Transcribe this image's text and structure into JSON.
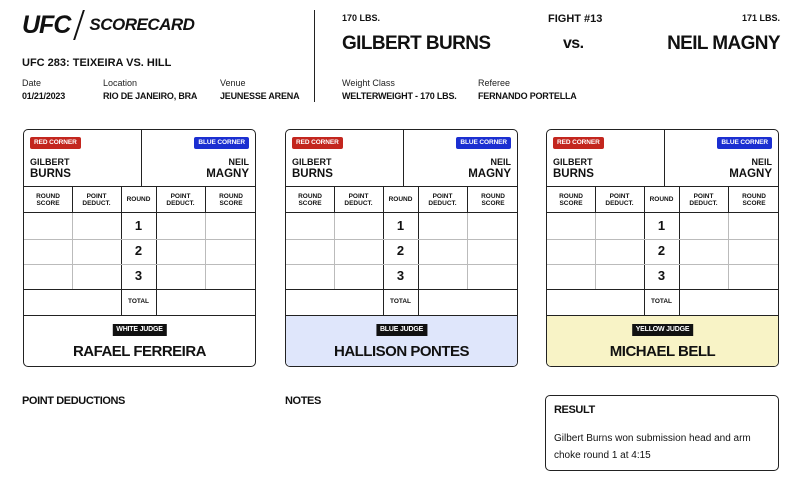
{
  "header": {
    "logo_text": "UFC",
    "logo_sub": "SCORECARD",
    "event": "UFC 283: TEIXEIRA VS. HILL",
    "date_label": "Date",
    "date": "01/21/2023",
    "location_label": "Location",
    "location": "RIO DE JANEIRO, BRA",
    "venue_label": "Venue",
    "venue": "JEUNESSE ARENA"
  },
  "fight": {
    "red_weight": "170 LBS.",
    "red_name": "GILBERT BURNS",
    "number": "FIGHT #13",
    "vs": "vs.",
    "blue_weight": "171 LBS.",
    "blue_name": "NEIL MAGNY",
    "weight_class_label": "Weight Class",
    "weight_class": "WELTERWEIGHT - 170 LBS.",
    "referee_label": "Referee",
    "referee": "FERNANDO PORTELLA"
  },
  "colors": {
    "red_corner": "#c3261e",
    "blue_corner": "#1b2fd1",
    "blue_judge_bg": "#dfe6fb",
    "yellow_judge_bg": "#f8f3c6"
  },
  "card_labels": {
    "red_corner": "RED CORNER",
    "blue_corner": "BLUE CORNER",
    "red_first": "GILBERT",
    "red_last": "BURNS",
    "blue_first": "NEIL",
    "blue_last": "MAGNY",
    "round_score": "ROUND SCORE",
    "point_deduct": "POINT DEDUCT.",
    "round": "ROUND",
    "rounds": [
      "1",
      "2",
      "3"
    ],
    "total": "TOTAL"
  },
  "judges": [
    {
      "tag": "WHITE JUDGE",
      "name": "RAFAEL FERREIRA"
    },
    {
      "tag": "BLUE JUDGE",
      "name": "HALLISON PONTES"
    },
    {
      "tag": "YELLOW JUDGE",
      "name": "MICHAEL BELL"
    }
  ],
  "sections": {
    "point_deductions": "POINT DEDUCTIONS",
    "notes": "NOTES"
  },
  "result": {
    "title": "RESULT",
    "text": "Gilbert Burns won submission head and arm choke round 1 at 4:15"
  }
}
